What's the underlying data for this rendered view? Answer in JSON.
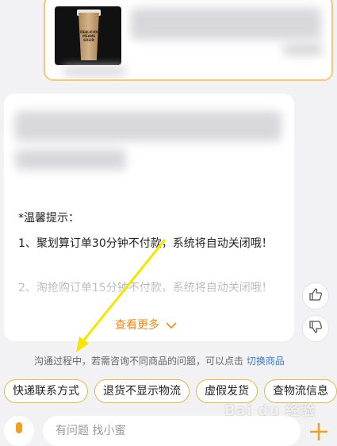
{
  "product_image": {
    "cup_print": "DEALICIOUS MEANS SOLID"
  },
  "message": {
    "tip_title": "*温馨提示：",
    "tip_1": "1、聚划算订单30分钟不付款，系统将自动关闭哦！",
    "tip_2": "2、淘抢购订单15分钟不付款，系统将自动关闭哦！",
    "see_more": "查看更多",
    "see_more_icon": "chevron-down-icon"
  },
  "feedback": {
    "like_icon": "thumbs-up-icon",
    "dislike_icon": "thumbs-down-icon"
  },
  "notice": {
    "text": "沟通过程中，若需咨询不同商品的问题，可以点击",
    "link": "切换商品"
  },
  "quick_replies": [
    "快递联系方式",
    "退货不显示物流",
    "虚假发货",
    "查物流信息"
  ],
  "input": {
    "placeholder": "有问题 找小蜜",
    "mic_icon": "microphone-icon",
    "plus_icon": "plus-icon"
  },
  "watermark": "Bai du 经验",
  "colors": {
    "accent_orange": "#e38a1c",
    "card_border": "#f5c878",
    "link_blue": "#3a7bd5",
    "annotation_arrow": "#f5e600"
  }
}
